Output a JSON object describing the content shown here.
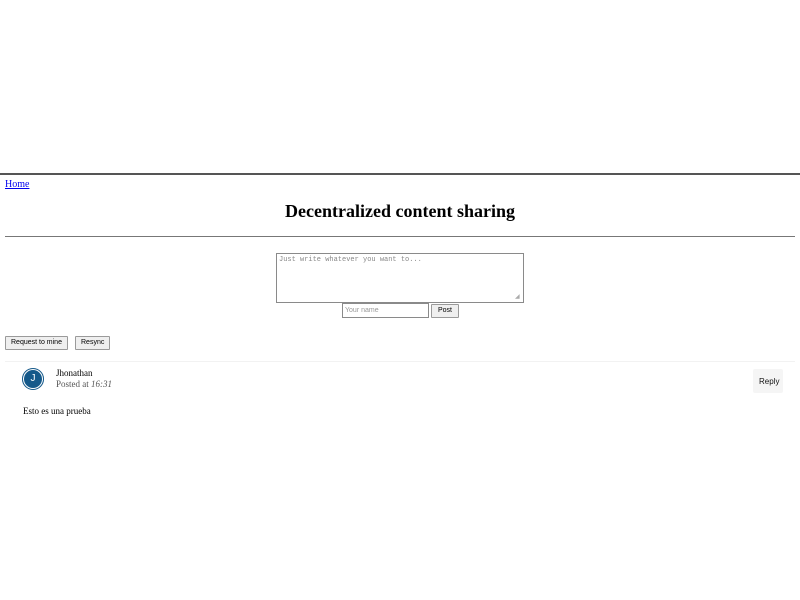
{
  "nav": {
    "home_label": "Home"
  },
  "header": {
    "title": "Decentralized content sharing"
  },
  "composer": {
    "textarea_placeholder": "Just write whatever you want to...",
    "name_placeholder": "Your name",
    "post_label": "Post"
  },
  "toolbar": {
    "request_label": "Request to mine",
    "resync_label": "Resync"
  },
  "comments": [
    {
      "avatar_initial": "J",
      "avatar_color": "#15598a",
      "author": "Jhonathan",
      "posted_prefix": "Posted at",
      "time": "16:31",
      "body": "Esto es una prueba",
      "reply_label": "Reply"
    }
  ],
  "colors": {
    "link": "#0000ee",
    "avatar": "#15598a",
    "button_bg": "#efefef",
    "rule": "#555555"
  },
  "icons": {
    "resize_grip": "resize-grip-icon"
  }
}
